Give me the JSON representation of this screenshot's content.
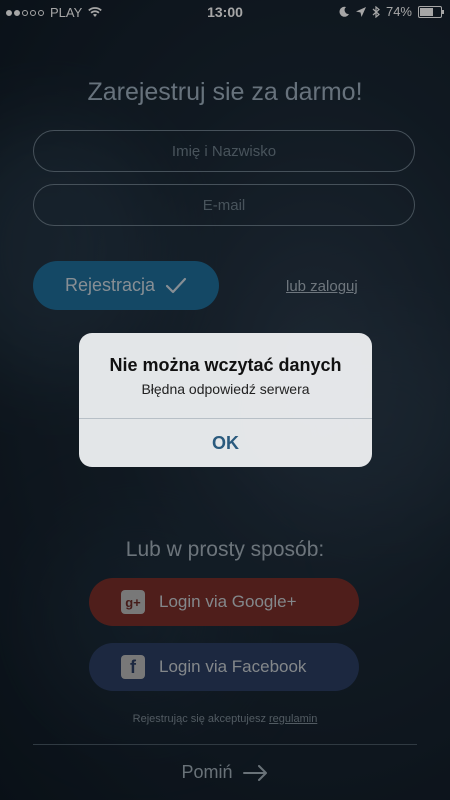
{
  "status_bar": {
    "carrier": "PLAY",
    "time": "13:00",
    "battery": "74%",
    "battery_level": 0.74,
    "icons": [
      "signal-dots-icon",
      "wifi-icon",
      "moon-icon",
      "location-arrow-icon",
      "bluetooth-icon",
      "battery-icon"
    ]
  },
  "registration": {
    "title": "Zarejestruj sie za darmo!",
    "name_placeholder": "Imię i Nazwisko",
    "email_placeholder": "E-mail",
    "register_label": "Rejestracja",
    "login_link": "lub zaloguj"
  },
  "social": {
    "heading": "Lub w prosty sposób:",
    "google_label": "Login via Google+",
    "google_icon_text": "g+",
    "facebook_label": "Login via Facebook",
    "facebook_icon_text": "f"
  },
  "footer": {
    "terms_text": "Rejestrując się akceptujesz ",
    "terms_link": "regulamin",
    "skip_label": "Pomiń"
  },
  "alert": {
    "title": "Nie można wczytać danych",
    "message": "Błędna odpowiedź serwera",
    "ok_label": "OK"
  }
}
